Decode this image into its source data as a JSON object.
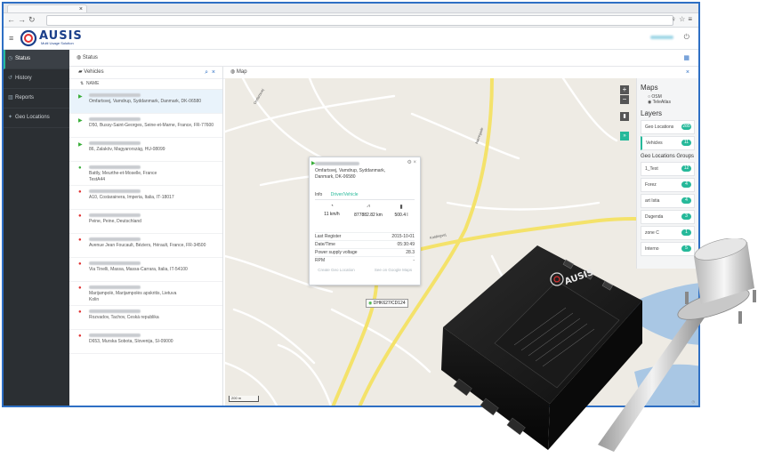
{
  "browser": {
    "tab_title": "",
    "url": "",
    "right_icons": "♀☆≡"
  },
  "app": {
    "logo_text": "AUSIS",
    "logo_sub": "Multi Usage Solution"
  },
  "sidebar": {
    "items": [
      {
        "icon": "dashboard-icon",
        "glyph": "◷",
        "label": "Status",
        "active": true
      },
      {
        "icon": "history-icon",
        "glyph": "↺",
        "label": "History",
        "active": false
      },
      {
        "icon": "reports-icon",
        "glyph": "▥",
        "label": "Reports",
        "active": false
      },
      {
        "icon": "geo-locations-icon",
        "glyph": "✦",
        "label": "Geo Locations",
        "active": false
      }
    ]
  },
  "statusbar": {
    "label": "Status"
  },
  "vehicles": {
    "title": "Vehicles",
    "column": "NAME",
    "rows": [
      {
        "status": "moving",
        "glyph": "▶",
        "address": "Omfartsvej, Vamdrup, Syddanmark, Danmark, DK-06580",
        "extra": ""
      },
      {
        "status": "moving",
        "glyph": "▶",
        "address": "D50, Bussy-Saint-Georges, Seine-et-Marne, France, FR-77600",
        "extra": ""
      },
      {
        "status": "moving",
        "glyph": "▶",
        "address": "86, Zalaköv, Magyarország, HU-08099",
        "extra": ""
      },
      {
        "status": "online",
        "glyph": "●",
        "address": "Battly, Meurthe-et-Moselle, France",
        "extra": "TestA44"
      },
      {
        "status": "stopped",
        "glyph": "●",
        "address": "A10, Costarainera, Imperia, Italia, IT-18017",
        "extra": ""
      },
      {
        "status": "stopped",
        "glyph": "●",
        "address": "Peine, Peine, Deutschland",
        "extra": ""
      },
      {
        "status": "stopped",
        "glyph": "●",
        "address": "Avenue Jean Foucault, Béziers, Hérault, France, FR-34500",
        "extra": ""
      },
      {
        "status": "stopped",
        "glyph": "●",
        "address": "Via Tinelli, Massa, Massa-Carrara, Italia, IT-54100",
        "extra": ""
      },
      {
        "status": "stopped",
        "glyph": "●",
        "address": "Marijampolė, Marijampolės apskritis, Lietuva",
        "extra": "Kolin"
      },
      {
        "status": "stopped",
        "glyph": "●",
        "address": "Rozvadov, Tachov, Česká republika",
        "extra": ""
      },
      {
        "status": "stopped",
        "glyph": "●",
        "address": "D653, Murska Sobota, Slovenija, SI-09000",
        "extra": ""
      }
    ]
  },
  "map": {
    "title": "Map",
    "scale": "200 m",
    "road_labels": [
      "Omfartsvej",
      "Koldingvej",
      "Nørregade"
    ],
    "popup": {
      "address": "Omfartsvej, Vamdrup, Syddanmark, Danmark, DK-06580",
      "tabs": [
        "Info",
        "Driver/Vehicle"
      ],
      "speed": "11 km/h",
      "odometer": "877882.82 km",
      "fuel": "500.4 l",
      "rows": [
        {
          "k": "Last Register",
          "v": "2015-10-01"
        },
        {
          "k": "Date/Time",
          "v": "05:30:49"
        },
        {
          "k": "Power supply voltage",
          "v": "28.3"
        },
        {
          "k": "RPM",
          "v": "-"
        }
      ],
      "buttons": [
        "Create Geo Location",
        "See on Google Maps"
      ]
    },
    "marker_label": "DHK627/CD124",
    "layers": {
      "maps_title": "Maps",
      "map_options": [
        "OSM",
        "TeleAtlas"
      ],
      "layers_title": "Layers",
      "items": [
        {
          "label": "Geo Locations",
          "count": "285"
        },
        {
          "label": "Vehicles",
          "count": "11"
        }
      ],
      "groups_title": "Geo Locations Groups",
      "groups": [
        {
          "label": "1_Test",
          "count": "12"
        },
        {
          "label": "Forez",
          "count": "4"
        },
        {
          "label": "art Istia",
          "count": "4"
        },
        {
          "label": "Dugenda",
          "count": "3"
        },
        {
          "label": "zone C",
          "count": "1"
        },
        {
          "label": "Interno",
          "count": "5"
        }
      ]
    }
  },
  "colors": {
    "accent": "#26b99a",
    "sidebar_bg": "#2b2f33",
    "frame_border": "#2e6fc4",
    "status_stopped": "#e03030",
    "status_moving": "#3aae3a"
  }
}
